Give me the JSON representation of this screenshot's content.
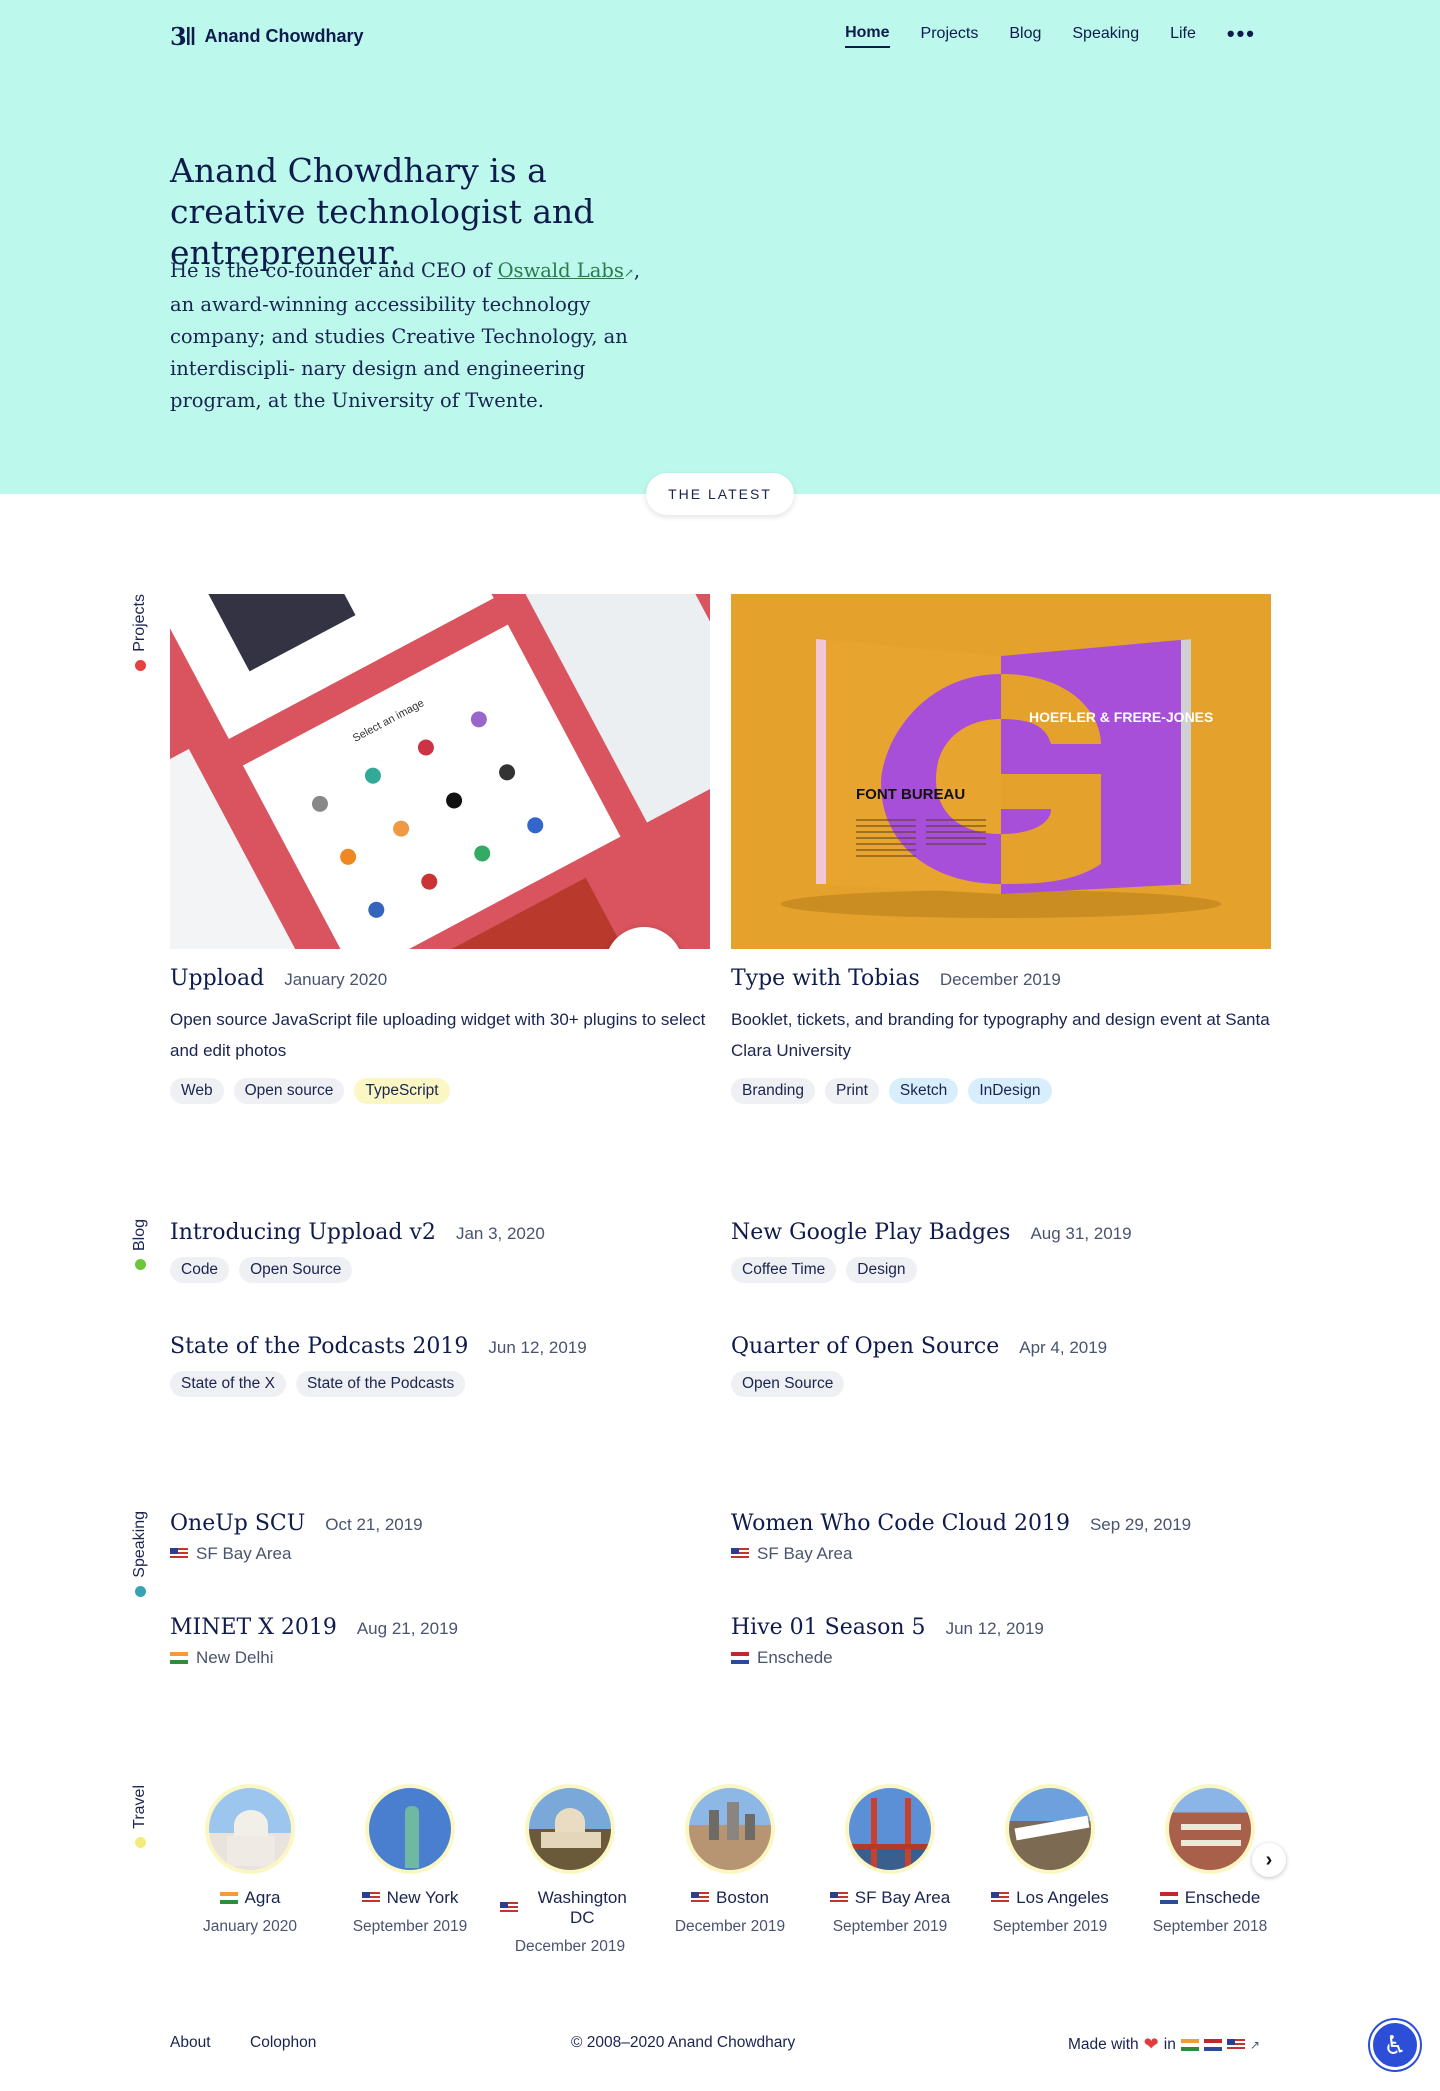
{
  "header": {
    "logo_mark": "3ǁ",
    "name": "Anand Chowdhary",
    "nav": [
      "Home",
      "Projects",
      "Blog",
      "Speaking",
      "Life"
    ],
    "more": "•••"
  },
  "hero": {
    "title": "Anand Chowdhary is a creative technologist and entrepreneur.",
    "text_before": "He is the co-founder and CEO of ",
    "link": "Oswald Labs",
    "text_after": ", an award-winning accessibility technology company; and studies Creative Technology, an interdiscipli- nary design and engineering program, at the University of Twente."
  },
  "latest_label": "THE LATEST",
  "sections": {
    "projects": "Projects",
    "blog": "Blog",
    "speaking": "Speaking",
    "travel": "Travel"
  },
  "colors": {
    "hero_bg": "#bcf8ec",
    "projects_dot": "#e5413f",
    "blog_dot": "#6cc63a",
    "speaking_dot": "#37a3b4",
    "travel_dot": "#f3ec7a"
  },
  "projects": [
    {
      "title": "Uppload",
      "date": "January 2020",
      "desc": "Open source JavaScript file uploading widget with 30+ plugins to select and edit photos",
      "tags": [
        "Web",
        "Open source",
        "TypeScript"
      ],
      "image_text": "Select an image"
    },
    {
      "title": "Type with Tobias",
      "date": "December 2019",
      "desc": "Booklet, tickets, and branding for typography and design event at Santa Clara University",
      "tags": [
        "Branding",
        "Print",
        "Sketch",
        "InDesign"
      ],
      "image_text_left": "FONT BUREAU",
      "image_text_right": "HOEFLER & FRERE-JONES"
    }
  ],
  "blog": [
    {
      "title": "Introducing Uppload v2",
      "date": "Jan 3, 2020",
      "tags": [
        "Code",
        "Open Source"
      ]
    },
    {
      "title": "New Google Play Badges",
      "date": "Aug 31, 2019",
      "tags": [
        "Coffee Time",
        "Design"
      ]
    },
    {
      "title": "State of the Podcasts 2019",
      "date": "Jun 12, 2019",
      "tags": [
        "State of the X",
        "State of the Podcasts"
      ]
    },
    {
      "title": "Quarter of Open Source",
      "date": "Apr 4, 2019",
      "tags": [
        "Open Source"
      ]
    }
  ],
  "speaking": [
    {
      "title": "OneUp SCU",
      "date": "Oct 21, 2019",
      "location": "SF Bay Area",
      "flag": "us"
    },
    {
      "title": "Women Who Code Cloud 2019",
      "date": "Sep 29, 2019",
      "location": "SF Bay Area",
      "flag": "us"
    },
    {
      "title": "MINET X 2019",
      "date": "Aug 21, 2019",
      "location": "New Delhi",
      "flag": "in"
    },
    {
      "title": "Hive 01 Season 5",
      "date": "Jun 12, 2019",
      "location": "Enschede",
      "flag": "nl"
    }
  ],
  "travel": [
    {
      "city": "Agra",
      "date": "January 2020",
      "flag": "in"
    },
    {
      "city": "New York",
      "date": "September 2019",
      "flag": "us"
    },
    {
      "city": "Washington DC",
      "date": "December 2019",
      "flag": "us"
    },
    {
      "city": "Boston",
      "date": "December 2019",
      "flag": "us"
    },
    {
      "city": "SF Bay Area",
      "date": "September 2019",
      "flag": "us"
    },
    {
      "city": "Los Angeles",
      "date": "September 2019",
      "flag": "us"
    },
    {
      "city": "Enschede",
      "date": "September 2018",
      "flag": "nl"
    }
  ],
  "footer": {
    "links": [
      "About",
      "Colophon"
    ],
    "copyright": "© 2008–2020 Anand Chowdhary",
    "made_with": "Made with",
    "in": "in"
  }
}
